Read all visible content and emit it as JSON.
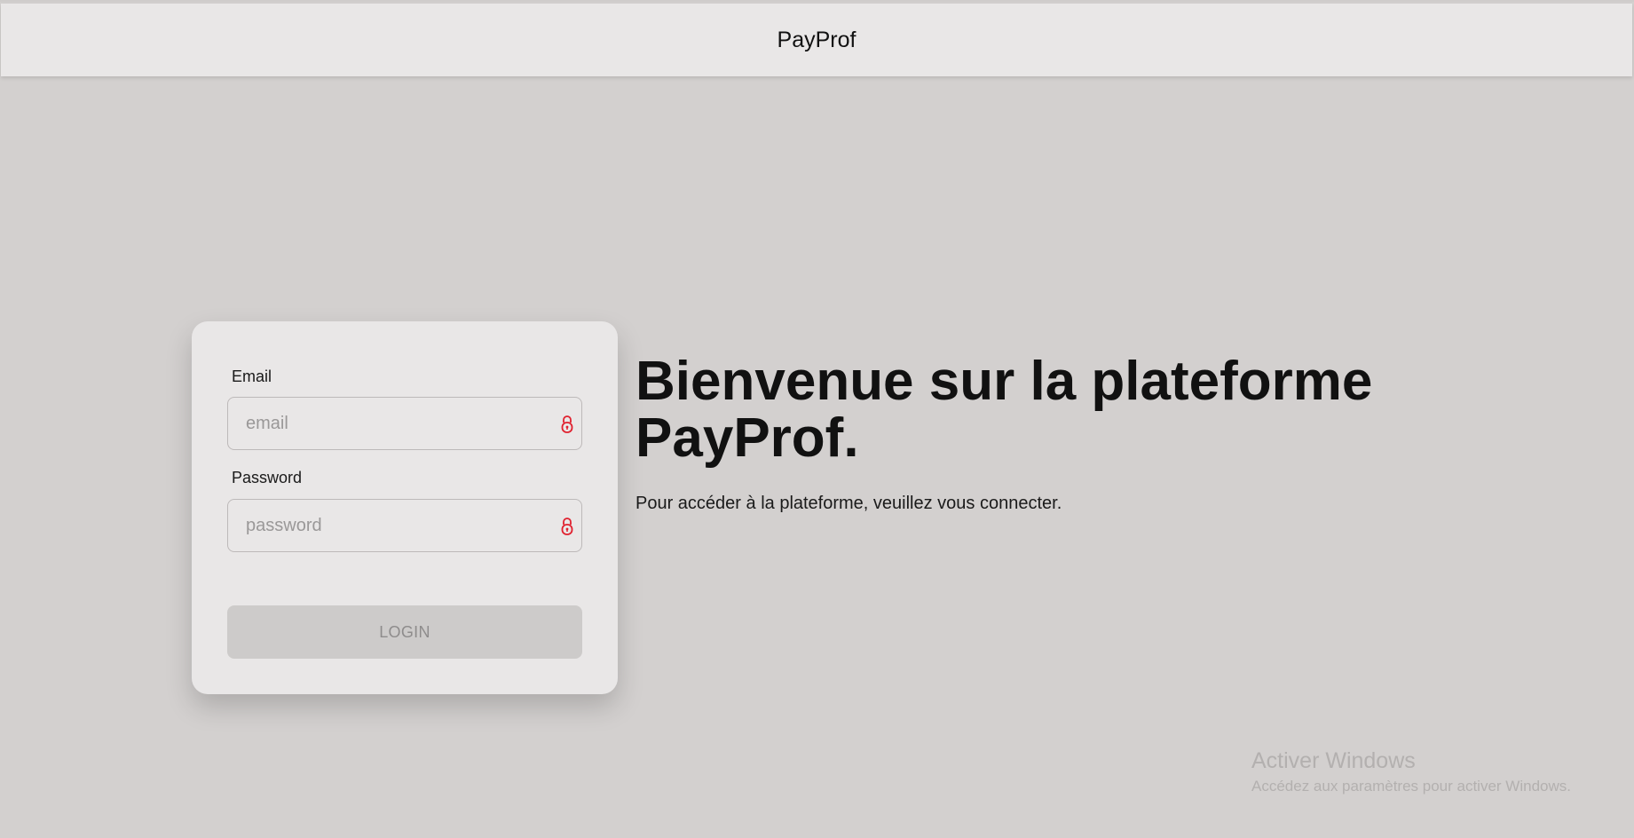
{
  "header": {
    "title": "PayProf"
  },
  "login": {
    "email_label": "Email",
    "email_placeholder": "email",
    "email_value": "",
    "password_label": "Password",
    "password_placeholder": "password",
    "password_value": "",
    "submit_label": "LOGIN",
    "icon": "lock-icon"
  },
  "welcome": {
    "title": "Bienvenue sur la plateforme PayProf.",
    "subtitle": "Pour accéder à la plateforme, veuillez vous connecter."
  },
  "watermark": {
    "title": "Activer Windows",
    "subtitle": "Accédez aux paramètres pour activer Windows."
  },
  "colors": {
    "background": "#d3d0cf",
    "card": "#e9e7e7",
    "accent_icon": "#e0202e",
    "button_disabled": "#cdcbca"
  }
}
